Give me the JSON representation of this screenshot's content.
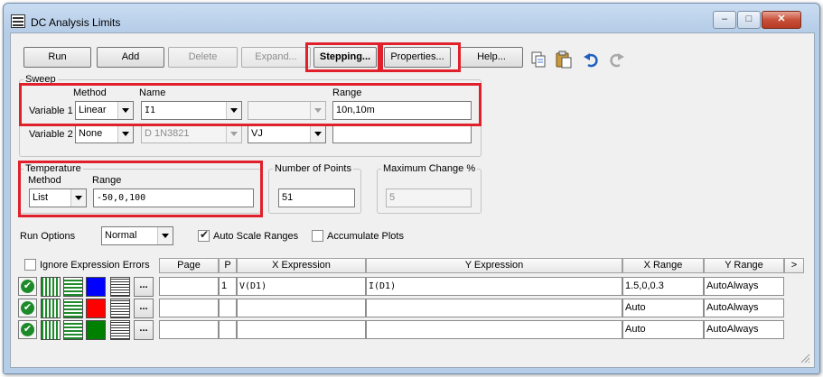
{
  "window": {
    "title": "DC Analysis Limits",
    "caption_buttons": [
      "–",
      "□",
      "✕"
    ]
  },
  "toolbar": {
    "run": "Run",
    "add": "Add",
    "delete": "Delete",
    "expand": "Expand...",
    "stepping": "Stepping...",
    "properties": "Properties...",
    "help": "Help...",
    "icons": [
      "copy-icon",
      "paste-icon",
      "undo-icon",
      "redo-icon"
    ]
  },
  "sweep": {
    "group_label": "Sweep",
    "col_method": "Method",
    "col_name": "Name",
    "col_range": "Range",
    "var1": {
      "label": "Variable 1",
      "method": "Linear",
      "name": "I1",
      "type": "",
      "range": "10n,10m"
    },
    "var2": {
      "label": "Variable 2",
      "method": "None",
      "name": "D 1N3821",
      "type": "VJ",
      "range": ""
    }
  },
  "temperature": {
    "group_label": "Temperature",
    "method_label": "Method",
    "range_label": "Range",
    "method": "List",
    "range": "-50,0,100"
  },
  "points": {
    "label": "Number of Points",
    "value": "51"
  },
  "max_change": {
    "label": "Maximum Change %",
    "value": "5"
  },
  "run_options": {
    "label": "Run Options",
    "mode": "Normal",
    "auto_scale": {
      "label": "Auto Scale Ranges",
      "checked": true
    },
    "accumulate": {
      "label": "Accumulate Plots",
      "checked": false
    }
  },
  "plots": {
    "ignore_errors": {
      "label": "Ignore Expression Errors",
      "checked": false
    },
    "headers": {
      "page": "Page",
      "p": "P",
      "x_expr": "X Expression",
      "y_expr": "Y Expression",
      "x_range": "X Range",
      "y_range": "Y Range",
      "more": ">"
    },
    "more_button": "...",
    "rows": [
      {
        "color": "#0000ff",
        "page": "",
        "p": "1",
        "x_expr": "V(D1)",
        "y_expr": "I(D1)",
        "x_range": "1.5,0,0.3",
        "y_range": "AutoAlways"
      },
      {
        "color": "#ff0000",
        "page": "",
        "p": "",
        "x_expr": "",
        "y_expr": "",
        "x_range": "Auto",
        "y_range": "AutoAlways"
      },
      {
        "color": "#008000",
        "page": "",
        "p": "",
        "x_expr": "",
        "y_expr": "",
        "x_range": "Auto",
        "y_range": "AutoAlways"
      }
    ]
  },
  "colors": {
    "highlight": "#e0202a",
    "check_green": "#1d8a2a"
  }
}
